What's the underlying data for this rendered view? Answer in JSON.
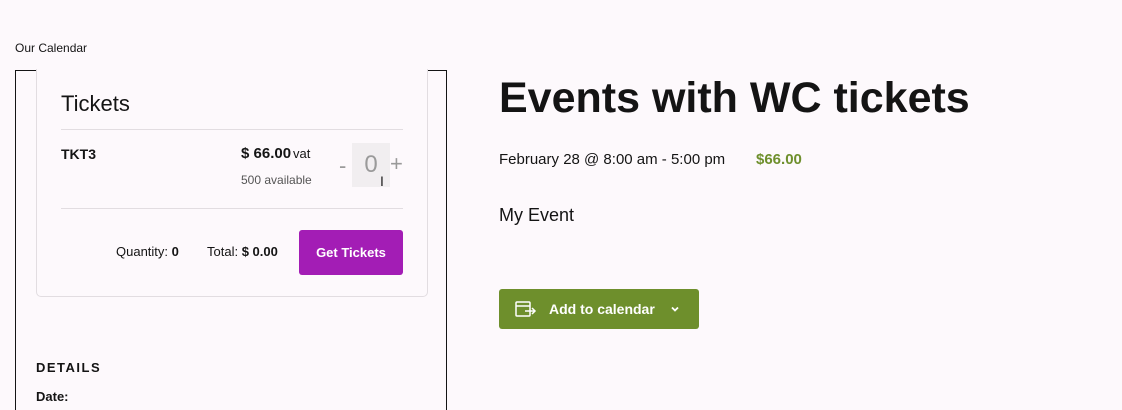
{
  "calendar_link": "Our Calendar",
  "tickets": {
    "title": "Tickets",
    "items": [
      {
        "name": "TKT3",
        "price": "$ 66.00",
        "price_suffix": "vat",
        "available": "500 available",
        "quantity_value": "0",
        "minus": "-",
        "plus": "+"
      }
    ],
    "quantity_label": "Quantity:",
    "quantity_value": "0",
    "total_label": "Total:",
    "total_value": "$ 0.00",
    "button_label": "Get Tickets"
  },
  "details": {
    "heading": "DETAILS",
    "date_label": "Date:"
  },
  "event": {
    "title": "Events with WC tickets",
    "date_range": "February 28 @ 8:00 am - 5:00 pm",
    "cost": "$66.00",
    "description": "My Event"
  },
  "add_to_calendar": {
    "label": "Add to calendar",
    "icon": "calendar-export-icon",
    "dropdown_icon": "chevron-down-icon"
  },
  "colors": {
    "accent_purple": "#a31db5",
    "accent_green": "#6e8f2c",
    "background": "#fdf9fc"
  }
}
